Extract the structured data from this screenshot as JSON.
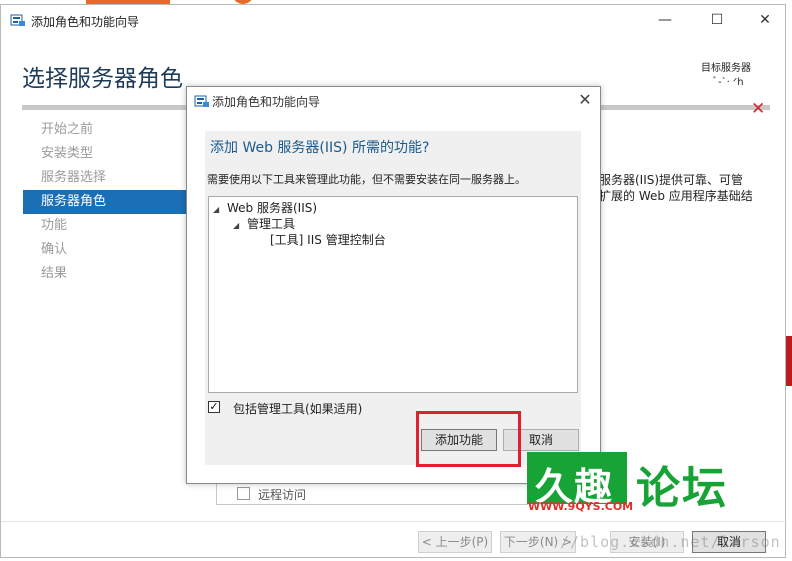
{
  "window": {
    "title": "添加角色和功能向导",
    "controls": {
      "minimize": "—",
      "maximize": "☐",
      "close": "✕"
    }
  },
  "page": {
    "title": "选择服务器角色",
    "target_label": "目标服务器",
    "target_name": "ﾞ‐ˋ‧ ᐟh"
  },
  "nav": {
    "items": [
      {
        "label": "开始之前",
        "active": false
      },
      {
        "label": "安装类型",
        "active": false
      },
      {
        "label": "服务器选择",
        "active": false
      },
      {
        "label": "服务器角色",
        "active": true
      },
      {
        "label": "功能",
        "active": false
      },
      {
        "label": "确认",
        "active": false
      },
      {
        "label": "结果",
        "active": false
      }
    ]
  },
  "background": {
    "desc_line1": "服务器(IIS)提供可靠、可管",
    "desc_line2": "扩展的 Web 应用程序基础结",
    "remote_access": "远程访问"
  },
  "footer": {
    "prev": "< 上一步(P)",
    "next": "下一步(N) >",
    "install": "安装(I)",
    "cancel": "取消"
  },
  "dialog": {
    "title": "添加角色和功能向导",
    "close": "✕",
    "heading": "添加 Web 服务器(IIS) 所需的功能?",
    "description": "需要使用以下工具来管理此功能，但不需要安装在同一服务器上。",
    "tree": [
      {
        "label": "Web 服务器(IIS)",
        "expander": "◢"
      },
      {
        "label": "管理工具",
        "expander": "◢"
      },
      {
        "label": "[工具] IIS 管理控制台",
        "expander": ""
      }
    ],
    "include_tools_label": "包括管理工具(如果适用)",
    "include_tools_checked": true,
    "check_mark": "✓",
    "add_button": "添加功能",
    "cancel_button": "取消"
  },
  "watermark": {
    "logo_main": "久趣",
    "logo_side": "论坛",
    "logo_url": "WWW.9QYS.COM",
    "url_text": "//blog.csdn.net/larson"
  },
  "colors": {
    "accent": "#1a6fb5",
    "heading": "#1b5a8c",
    "highlight": "#e02030",
    "logo_green": "#17a335"
  }
}
